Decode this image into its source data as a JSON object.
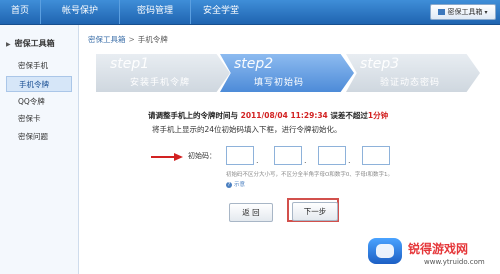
{
  "nav": {
    "items": [
      "首页",
      "帐号保护",
      "密码管理",
      "安全学堂"
    ],
    "tool_button": "密保工具箱"
  },
  "sidebar": {
    "title": "密保工具箱",
    "items": [
      "密保手机",
      "手机令牌",
      "QQ令牌",
      "密保卡",
      "密保问题"
    ],
    "active_index": 1
  },
  "breadcrumb": {
    "root": "密保工具箱",
    "separator": ">",
    "current": "手机令牌"
  },
  "steps": [
    {
      "num": "step1",
      "label": "安装手机令牌"
    },
    {
      "num": "step2",
      "label": "填写初始码"
    },
    {
      "num": "step3",
      "label": "验证动态密码"
    }
  ],
  "instructions": {
    "line1_prefix": "请调整手机上的令牌时间与",
    "line1_time": "2011/08/04 11:29:34",
    "line1_mid": "误差不超过",
    "line1_limit": "1分钟",
    "line2": "将手机上显示的24位初始码填入下框，进行令牌初始化。"
  },
  "form": {
    "label": "初始码：",
    "hint": "初始码不区分大小写，不区分全半角字母O和数字0、字母I和数字1。",
    "help_link": "示意"
  },
  "buttons": {
    "back": "返 回",
    "next": "下一步"
  },
  "watermark": {
    "name": "锐得游戏网",
    "url": "www.ytruido.com"
  },
  "colors": {
    "nav_blue": "#2a73c4",
    "step_active": "#5b97dd",
    "highlight_red": "#d2504c"
  }
}
